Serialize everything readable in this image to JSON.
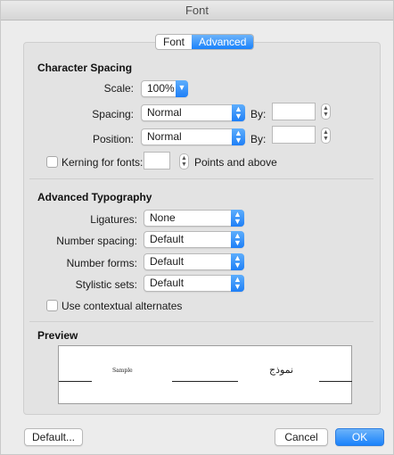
{
  "window": {
    "title": "Font"
  },
  "tabs": [
    {
      "label": "Font"
    },
    {
      "label": "Advanced"
    }
  ],
  "character_spacing": {
    "title": "Character Spacing",
    "scale_label": "Scale:",
    "scale_value": "100%",
    "spacing_label": "Spacing:",
    "spacing_value": "Normal",
    "spacing_by_label": "By:",
    "spacing_by_value": "",
    "position_label": "Position:",
    "position_value": "Normal",
    "position_by_label": "By:",
    "position_by_value": "",
    "kerning_label": "Kerning for fonts:",
    "kerning_value": "",
    "kerning_suffix": "Points and above",
    "kerning_checked": false
  },
  "advanced_typography": {
    "title": "Advanced Typography",
    "ligatures_label": "Ligatures:",
    "ligatures_value": "None",
    "number_spacing_label": "Number spacing:",
    "number_spacing_value": "Default",
    "number_forms_label": "Number forms:",
    "number_forms_value": "Default",
    "stylistic_sets_label": "Stylistic sets:",
    "stylistic_sets_value": "Default",
    "contextual_label": "Use contextual alternates",
    "contextual_checked": false
  },
  "preview": {
    "title": "Preview",
    "sample_text": "Sample",
    "arabic_text": "نموذج"
  },
  "buttons": {
    "default": "Default...",
    "cancel": "Cancel",
    "ok": "OK"
  },
  "colors": {
    "accent": "#1a82fb"
  }
}
